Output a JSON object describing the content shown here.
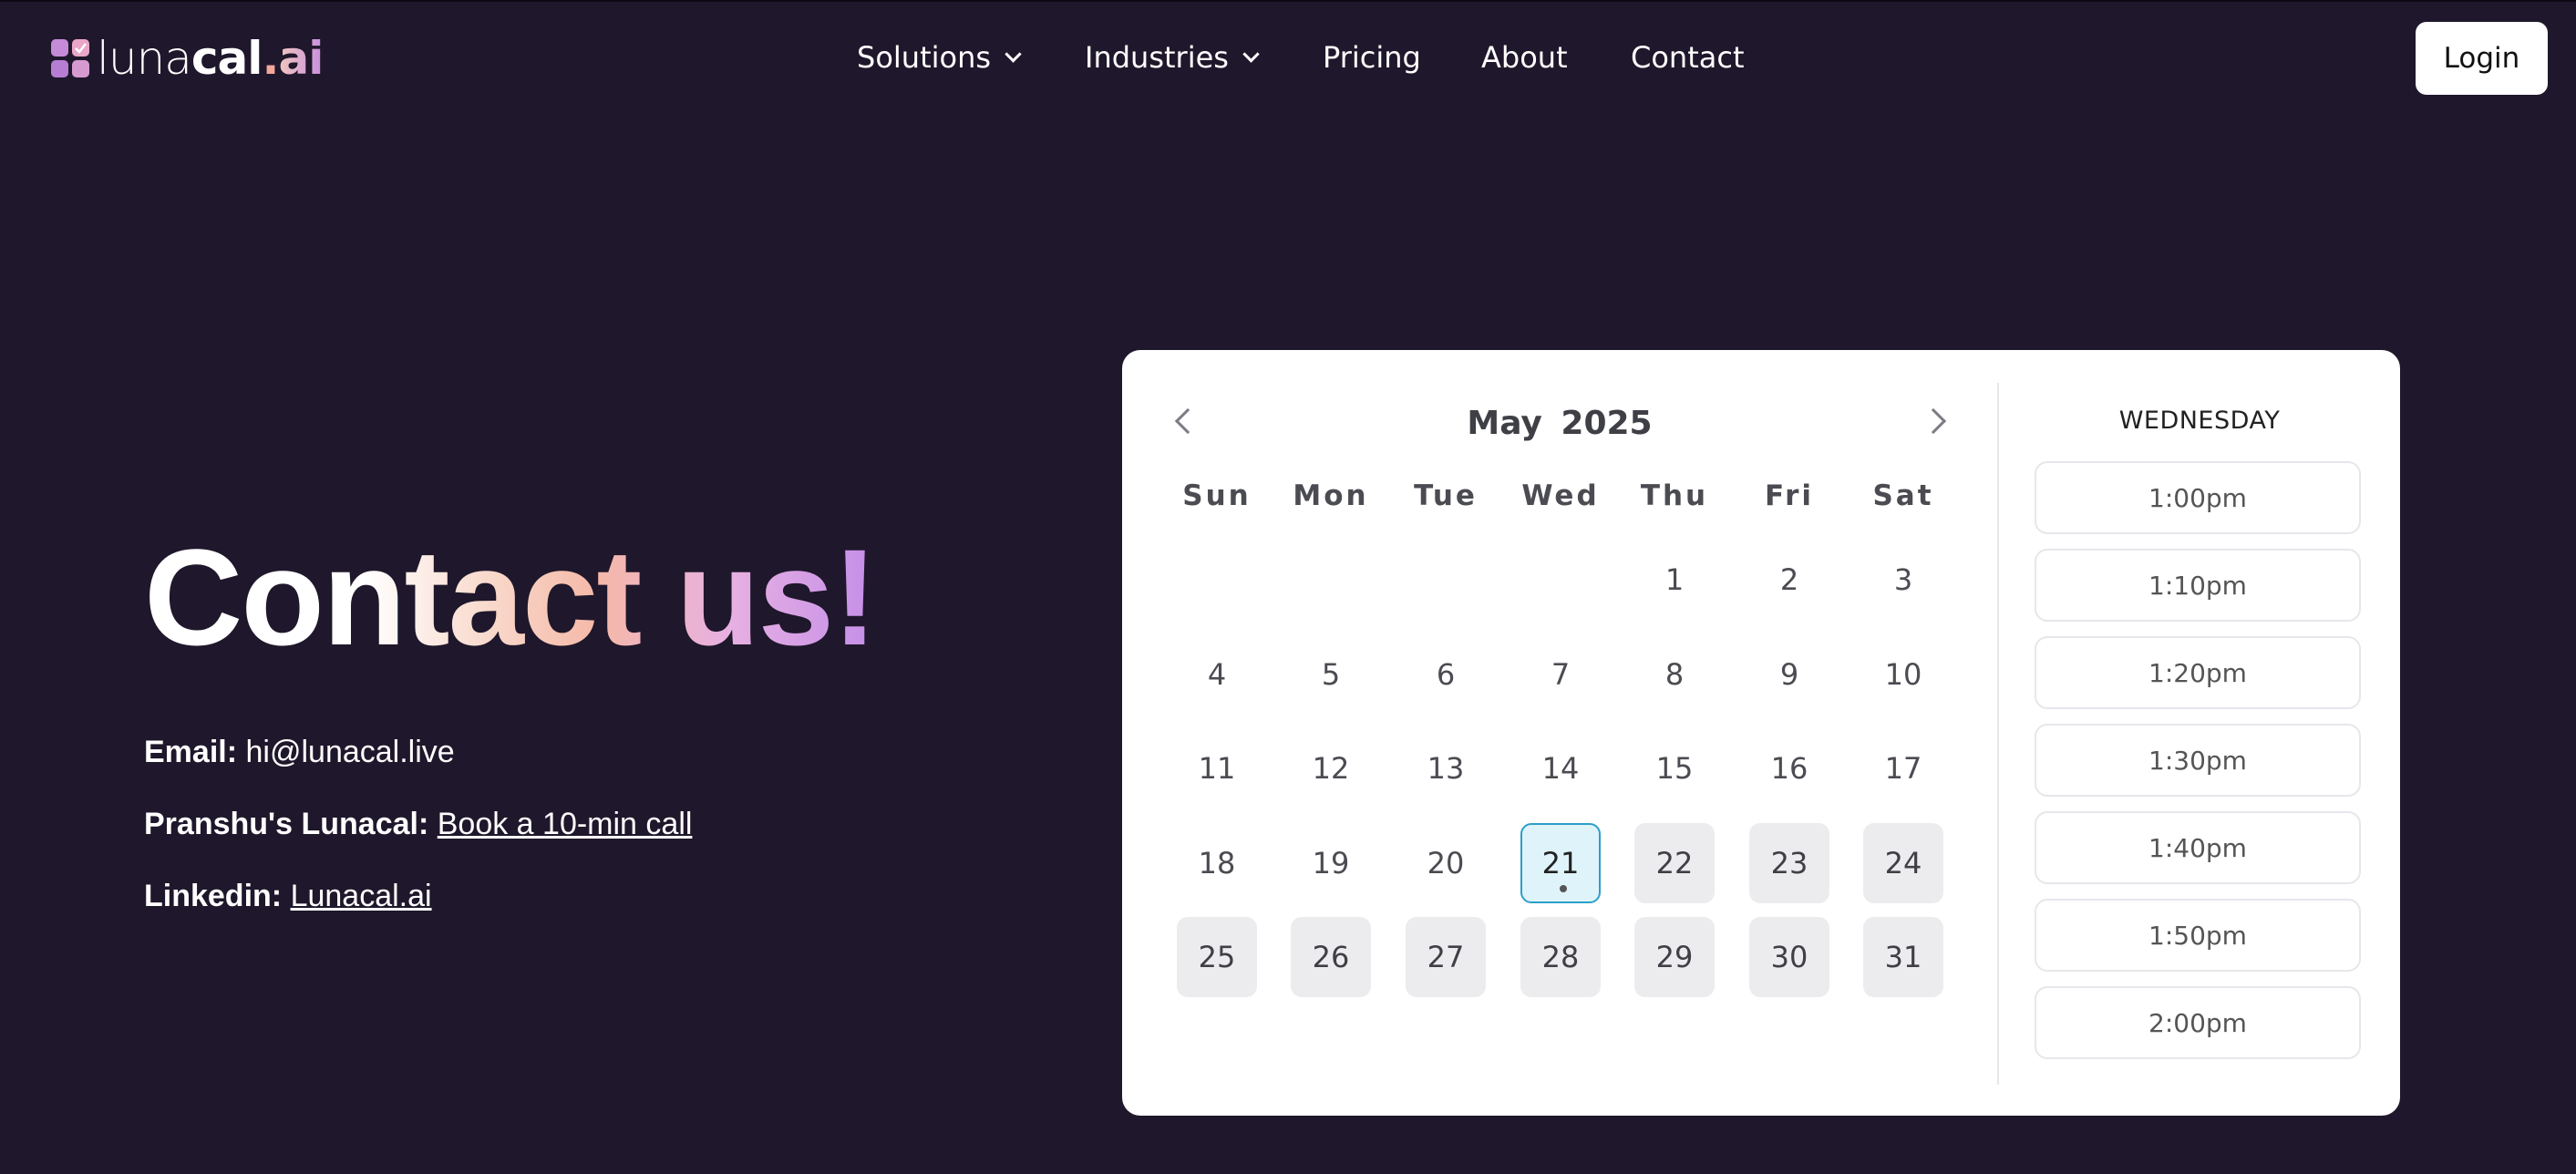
{
  "header": {
    "logo": {
      "luna": "luna",
      "cal": "cal",
      "dot": ".",
      "ai": "ai"
    },
    "nav": [
      {
        "label": "Solutions",
        "dropdown": true
      },
      {
        "label": "Industries",
        "dropdown": true
      },
      {
        "label": "Pricing",
        "dropdown": false
      },
      {
        "label": "About",
        "dropdown": false
      },
      {
        "label": "Contact",
        "dropdown": false
      }
    ],
    "login_label": "Login"
  },
  "hero": {
    "title": "Contact us!",
    "email_label": "Email:",
    "email_value": "hi@lunacal.live",
    "lunacal_label": "Pranshu's Lunacal:",
    "lunacal_link": "Book a 10-min call",
    "linkedin_label": "Linkedin:",
    "linkedin_link": "Lunacal.ai"
  },
  "calendar": {
    "month": "May",
    "year": "2025",
    "weekdays": [
      "Sun",
      "Mon",
      "Tue",
      "Wed",
      "Thu",
      "Fri",
      "Sat"
    ],
    "first_weekday_index": 4,
    "days_in_month": 31,
    "selected_day": 21,
    "available_days": [
      22,
      23,
      24,
      25,
      26,
      27,
      28,
      29,
      30,
      31
    ],
    "selected_weekday_label": "WEDNESDAY",
    "time_slots": [
      "1:00pm",
      "1:10pm",
      "1:20pm",
      "1:30pm",
      "1:40pm",
      "1:50pm",
      "2:00pm"
    ]
  }
}
